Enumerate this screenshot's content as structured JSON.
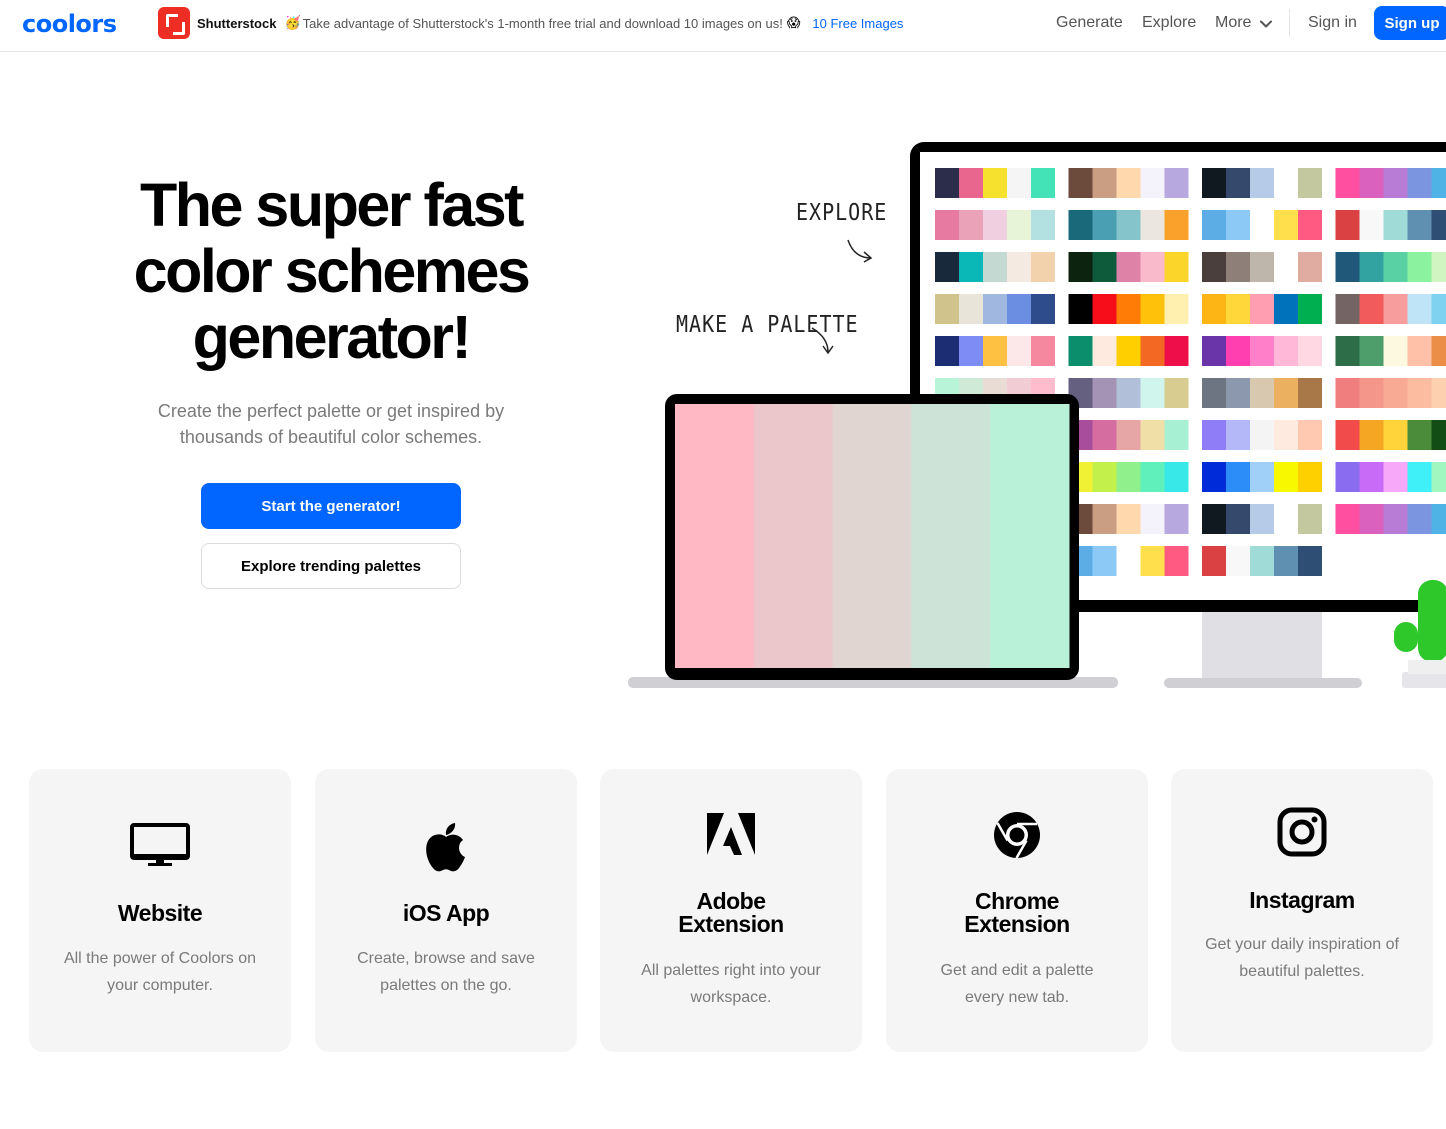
{
  "nav": {
    "logo": "coolors",
    "promo": {
      "brand": "Shutterstock",
      "emoji_left": "🥳",
      "text": "Take advantage of Shutterstock's 1-month free trial and download 10 images on us!",
      "emoji_right": "😱",
      "link": "10 Free Images"
    },
    "links": [
      "Generate",
      "Explore",
      "More"
    ],
    "sign_in": "Sign in",
    "sign_up": "Sign up"
  },
  "hero": {
    "title_lines": [
      "The super fast",
      "color schemes",
      "generator!"
    ],
    "subtitle": "Create the perfect palette or get inspired by thousands of beautiful color schemes.",
    "primary_button": "Start the generator!",
    "secondary_button": "Explore trending palettes"
  },
  "illustration": {
    "explore_label": "EXPLORE",
    "make_label": "MAKE A PALETTE",
    "laptop_palette": [
      "#ffb8c4",
      "#ebc6ca",
      "#e0d5d0",
      "#cde3d8",
      "#b8f0d8"
    ],
    "monitor_palettes": [
      [
        "#2b2d4a",
        "#e9678f",
        "#f6e22e",
        "#f5f5f5",
        "#43e3b7"
      ],
      [
        "#6c4a3c",
        "#c99e83",
        "#ffd8ad",
        "#f4f2fb",
        "#b7a8e0"
      ],
      [
        "#101820",
        "#34496b",
        "#b5cbe8",
        "#ffffff",
        "#c4c89e"
      ],
      [
        "#ff4fa0",
        "#da61bd",
        "#b97cd6",
        "#7c95e0",
        "#4fb3e6"
      ],
      [
        "#e77aa0",
        "#eaa2b9",
        "#f0d0e0",
        "#e8f4d8",
        "#b3e0e0"
      ],
      [
        "#19697a",
        "#4a9fb3",
        "#86c4cc",
        "#ebe6e0",
        "#f9a12b"
      ],
      [
        "#5cade6",
        "#8dc9f6",
        "#ffffff",
        "#ffe04c",
        "#ff5a82"
      ],
      [
        "#d94142",
        "#f8f8f8",
        "#a0dbd7",
        "#5f8fb1",
        "#2f4e74"
      ],
      [
        "#17293b",
        "#0ab8b7",
        "#c4d9d2",
        "#f5eae2",
        "#f2d1ad"
      ],
      [
        "#0c2310",
        "#0d5b3b",
        "#df82a8",
        "#f9bacb",
        "#fbd52a"
      ],
      [
        "#4a3f3c",
        "#8e8078",
        "#bfb6ab",
        "#ffffff",
        "#e0aba0"
      ],
      [
        "#1f5878",
        "#32a3a0",
        "#5ad1a4",
        "#8bf2a0",
        "#d0f5c0"
      ],
      [
        "#d0c48c",
        "#e8e4da",
        "#a0b8e0",
        "#6b8ee3",
        "#2e4b8c"
      ],
      [
        "#000000",
        "#f70d19",
        "#ff7d06",
        "#ffc10a",
        "#fff0b0"
      ],
      [
        "#fdb515",
        "#ffd73a",
        "#ff9eb0",
        "#0072bb",
        "#00b050"
      ],
      [
        "#756464",
        "#f25b5b",
        "#f79d9d",
        "#bfe3f7",
        "#7fd2f0"
      ],
      [
        "#1d2d73",
        "#7d8df5",
        "#fec141",
        "#fce8e8",
        "#f5889f"
      ],
      [
        "#0a8e6c",
        "#ffeadf",
        "#ffcf00",
        "#f36822",
        "#ee0e49"
      ],
      [
        "#6a35a8",
        "#ff3eb0",
        "#ff80c8",
        "#ffb8d8",
        "#ffd8e4"
      ],
      [
        "#2d6e48",
        "#4d9e6a",
        "#fdf8e0",
        "#ffc2a8",
        "#ea8e48"
      ],
      [
        "#b8f4d8",
        "#d0ead8",
        "#e8dcd4",
        "#f2ccd4",
        "#ffbccc"
      ],
      [
        "#655f80",
        "#a493b5",
        "#b1c0d8",
        "#d0f5ec",
        "#d8cc90"
      ],
      [
        "#6e7582",
        "#8b98ad",
        "#d8c8b0",
        "#ebb060",
        "#a87848"
      ],
      [
        "#f07e7e",
        "#f5968a",
        "#f8aa94",
        "#fbbca0",
        "#fdd0b0"
      ],
      [
        "#f06470",
        "#e8908c",
        "#d8b4b4",
        "#b4d4d8",
        "#98f8f8"
      ],
      [
        "#a84d9c",
        "#d66da0",
        "#e6a6a6",
        "#f0e0a8",
        "#a8f0d4"
      ],
      [
        "#8f7cf7",
        "#b4b8f8",
        "#f4f4f4",
        "#ffeadf",
        "#ffc8b0"
      ],
      [
        "#f24b4b",
        "#f5a623",
        "#ffd43b",
        "#4a8c3a",
        "#134d16"
      ],
      [
        "#060606",
        "#3a74f2",
        "#e82c36",
        "#ffc93c",
        "#e8e8e8"
      ],
      [
        "#f0f034",
        "#c4f04c",
        "#90f08c",
        "#60f0bc",
        "#38e8e8"
      ],
      [
        "#002bd8",
        "#2c8cf8",
        "#a0d0f8",
        "#f8f800",
        "#ffd000"
      ],
      [
        "#8a6cf0",
        "#c86cf8",
        "#f8a8f8",
        "#40f0f8",
        "#a0f8c0"
      ],
      [
        "#0026a0",
        "#5048e0",
        "#9878d8",
        "#f0a098",
        "#b8e8e0"
      ],
      [
        "#6c4a3c",
        "#c99e83",
        "#ffd8ad",
        "#f4f2fb",
        "#b7a8e0"
      ],
      [
        "#101820",
        "#34496b",
        "#b5cbe8",
        "#ffffff",
        "#c4c89e"
      ],
      [
        "#ff4fa0",
        "#da61bd",
        "#b97cd6",
        "#7c95e0",
        "#4fb3e6"
      ],
      [
        "#19697a",
        "#4a9fb3",
        "#86c4cc",
        "#ebe6e0",
        "#f9a12b"
      ],
      [
        "#5cade6",
        "#8dc9f6",
        "#ffffff",
        "#ffe04c",
        "#ff5a82"
      ],
      [
        "#d94142",
        "#f8f8f8",
        "#a0dbd7",
        "#5f8fb1",
        "#2f4e74"
      ]
    ]
  },
  "cards": [
    {
      "icon": "monitor-icon",
      "title_lines": [
        "Website"
      ],
      "desc": "All the power of Coolors on your computer."
    },
    {
      "icon": "apple-icon",
      "title_lines": [
        "iOS App"
      ],
      "desc": "Create, browse and save palettes on the go."
    },
    {
      "icon": "adobe-icon",
      "title_lines": [
        "Adobe",
        "Extension"
      ],
      "desc": "All palettes right into your workspace."
    },
    {
      "icon": "chrome-icon",
      "title_lines": [
        "Chrome",
        "Extension"
      ],
      "desc": "Get and edit a palette every new tab."
    },
    {
      "icon": "instagram-icon",
      "title_lines": [
        "Instagram"
      ],
      "desc": "Get your daily inspiration of beautiful palettes."
    }
  ]
}
